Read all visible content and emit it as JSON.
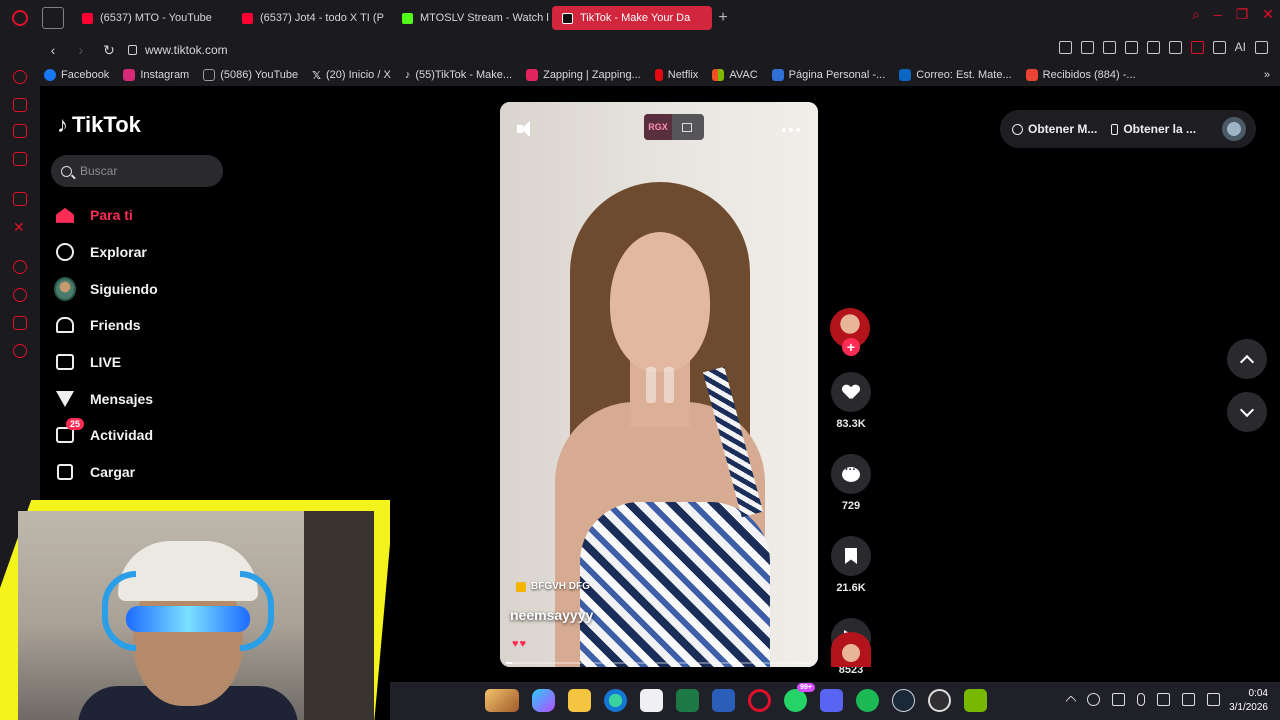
{
  "browser": {
    "tabs": [
      {
        "label": "(6537) MTO - YouTube",
        "favicon": "youtube-icon"
      },
      {
        "label": "(6537) Jot4 - todo X TI (P",
        "favicon": "youtube-icon"
      },
      {
        "label": "MTOSLV Stream - Watch l",
        "favicon": "kick-icon"
      },
      {
        "label": "TikTok - Make Your Da",
        "favicon": "tiktok-icon",
        "active": true
      }
    ],
    "url": "www.tiktok.com",
    "bookmarks": [
      {
        "label": "Facebook",
        "color": "#1877f2"
      },
      {
        "label": "Instagram",
        "color": "#d62976"
      },
      {
        "label": "(5086) YouTube",
        "color": "#9a9aa0"
      },
      {
        "label": "(20) Inicio / X",
        "color": "#111111"
      },
      {
        "label": "(55)TikTok - Make...",
        "color": "#111111"
      },
      {
        "label": "Zapping | Zapping...",
        "color": "#e0245e"
      },
      {
        "label": "Netflix",
        "color": "#e50914"
      },
      {
        "label": "AVAC",
        "color": "#f25022"
      },
      {
        "label": "Página Personal -...",
        "color": "#2f6fd6"
      },
      {
        "label": "Correo: Est. Mate...",
        "color": "#0a66c2"
      },
      {
        "label": "Recibidos (884) -...",
        "color": "#ea4335"
      }
    ],
    "toolbar_right_label": "AI"
  },
  "tiktok": {
    "logo_text": "TikTok",
    "search": {
      "placeholder": "Buscar"
    },
    "nav": [
      {
        "label": "Para ti",
        "icon": "home-icon",
        "active": true
      },
      {
        "label": "Explorar",
        "icon": "compass-icon"
      },
      {
        "label": "Siguiendo",
        "icon": "avatar-icon"
      },
      {
        "label": "Friends",
        "icon": "friends-icon"
      },
      {
        "label": "LIVE",
        "icon": "live-icon"
      },
      {
        "label": "Mensajes",
        "icon": "send-icon"
      },
      {
        "label": "Actividad",
        "icon": "activity-icon",
        "badge": "25"
      },
      {
        "label": "Cargar",
        "icon": "upload-icon"
      }
    ],
    "video": {
      "overlay_badge": "RGX",
      "author_tag": "BFGVH DFG",
      "username": "neemsayyyy",
      "caption_emoji": "♥♥",
      "progress": 0.02
    },
    "actions": {
      "likes": "83.3K",
      "comments": "729",
      "saves": "21.6K",
      "shares": "8523"
    },
    "get_app": {
      "item1": "Obtener M...",
      "item2": "Obtener la ..."
    }
  },
  "taskbar": {
    "apps": [
      "explorer-preview",
      "copilot",
      "file-explorer",
      "edge",
      "store",
      "excel",
      "word",
      "opera",
      "whatsapp",
      "discord",
      "spotify",
      "steam",
      "obs",
      "nvidia"
    ],
    "whatsapp_badge": "99+",
    "time": "0:04",
    "date": "3/1/2026"
  },
  "colors": {
    "tiktok_accent": "#fe2c55",
    "opera_red": "#e0102a",
    "active_tab": "#d1263b"
  }
}
